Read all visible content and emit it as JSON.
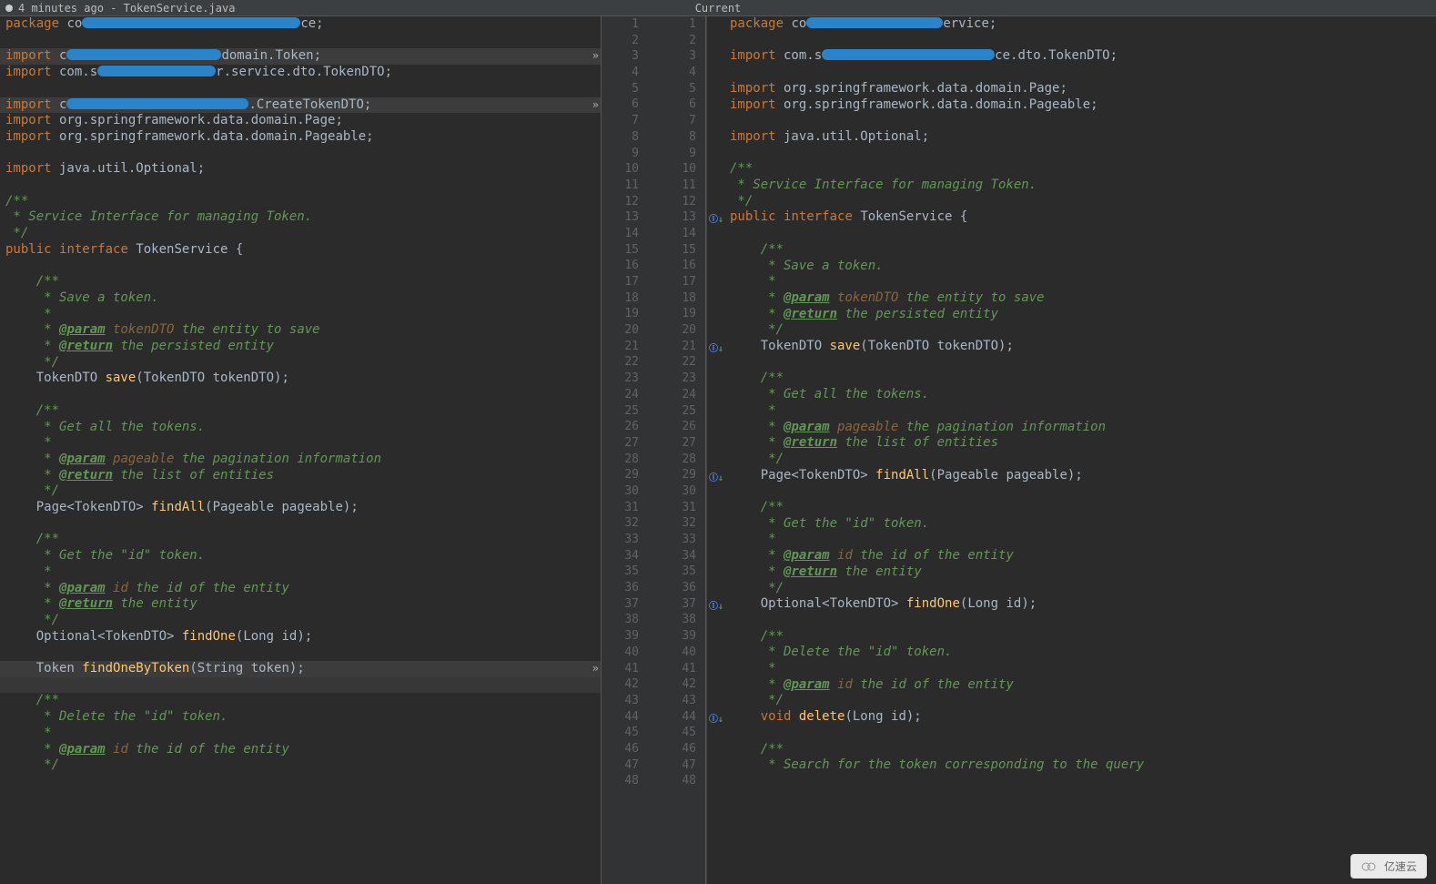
{
  "header": {
    "timestamp": "4 minutes ago",
    "filename": "TokenService.java",
    "center_label": "Current"
  },
  "left": {
    "lines": [
      {
        "n": 1,
        "t": "pkg",
        "raw": "package co[R:240]ce;"
      },
      {
        "n": 2,
        "t": "blank"
      },
      {
        "n": 3,
        "t": "imp",
        "raw": "import c[R:170]domain.Token;",
        "hl": true,
        "chev": true
      },
      {
        "n": 4,
        "t": "imp",
        "raw": "import com.s[R:130]r.service.dto.TokenDTO;"
      },
      {
        "n": 5,
        "t": "blank"
      },
      {
        "n": 6,
        "t": "imp",
        "raw": "import c[R:200].CreateTokenDTO;",
        "hl": true,
        "chev": true
      },
      {
        "n": 7,
        "t": "imp",
        "raw": "import org.springframework.data.domain.Page;"
      },
      {
        "n": 8,
        "t": "imp",
        "raw": "import org.springframework.data.domain.Pageable;"
      },
      {
        "n": 9,
        "t": "blank"
      },
      {
        "n": 10,
        "t": "imp",
        "raw": "import java.util.Optional;"
      },
      {
        "n": 11,
        "t": "blank"
      },
      {
        "n": 12,
        "t": "doc",
        "raw": "/**"
      },
      {
        "n": 13,
        "t": "doc",
        "raw": " * Service Interface for managing Token."
      },
      {
        "n": 14,
        "t": "doc",
        "raw": " */"
      },
      {
        "n": 15,
        "t": "iface",
        "raw": "public interface TokenService {"
      },
      {
        "n": 16,
        "t": "blank"
      },
      {
        "n": 17,
        "t": "doc",
        "raw": "    /**"
      },
      {
        "n": 18,
        "t": "doc",
        "raw": "     * Save a token."
      },
      {
        "n": 19,
        "t": "doc",
        "raw": "     *"
      },
      {
        "n": 20,
        "t": "docp",
        "param": "tokenDTO",
        "rest": "the entity to save"
      },
      {
        "n": 21,
        "t": "docr",
        "rest": "the persisted entity"
      },
      {
        "n": 22,
        "t": "doc",
        "raw": "     */"
      },
      {
        "n": 23,
        "t": "sig",
        "raw": "    TokenDTO save(TokenDTO tokenDTO);",
        "fn": "save"
      },
      {
        "n": 24,
        "t": "blank"
      },
      {
        "n": 25,
        "t": "doc",
        "raw": "    /**"
      },
      {
        "n": 26,
        "t": "doc",
        "raw": "     * Get all the tokens."
      },
      {
        "n": 27,
        "t": "doc",
        "raw": "     *"
      },
      {
        "n": 28,
        "t": "docp",
        "param": "pageable",
        "rest": "the pagination information"
      },
      {
        "n": 29,
        "t": "docr",
        "rest": "the list of entities"
      },
      {
        "n": 30,
        "t": "doc",
        "raw": "     */"
      },
      {
        "n": 31,
        "t": "sig",
        "raw": "    Page<TokenDTO> findAll(Pageable pageable);",
        "fn": "findAll"
      },
      {
        "n": 32,
        "t": "blank"
      },
      {
        "n": 33,
        "t": "doc",
        "raw": "    /**"
      },
      {
        "n": 34,
        "t": "doc",
        "raw": "     * Get the \"id\" token."
      },
      {
        "n": 35,
        "t": "doc",
        "raw": "     *"
      },
      {
        "n": 36,
        "t": "docp",
        "param": "id",
        "rest": "the id of the entity"
      },
      {
        "n": 37,
        "t": "docr",
        "rest": "the entity"
      },
      {
        "n": 38,
        "t": "doc",
        "raw": "     */"
      },
      {
        "n": 39,
        "t": "sig",
        "raw": "    Optional<TokenDTO> findOne(Long id);",
        "fn": "findOne"
      },
      {
        "n": 40,
        "t": "blank"
      },
      {
        "n": 41,
        "t": "sig",
        "raw": "    Token findOneByToken(String token);",
        "fn": "findOneByToken",
        "hl": true,
        "chev": true
      },
      {
        "n": 42,
        "t": "blank",
        "hl": true,
        "hl2": true
      },
      {
        "n": 43,
        "t": "doc",
        "raw": "    /**"
      },
      {
        "n": 44,
        "t": "doc",
        "raw": "     * Delete the \"id\" token."
      },
      {
        "n": 45,
        "t": "doc",
        "raw": "     *"
      },
      {
        "n": 46,
        "t": "docp",
        "param": "id",
        "rest": "the id of the entity"
      },
      {
        "n": 47,
        "t": "doc",
        "raw": "     */"
      }
    ]
  },
  "right": {
    "lines": [
      {
        "n": 1,
        "t": "pkg",
        "raw": "package co[R:150]ervice;"
      },
      {
        "n": 2,
        "t": "blank"
      },
      {
        "n": 3,
        "t": "imp",
        "raw": "import com.s[R:190]ce.dto.TokenDTO;"
      },
      {
        "n": 4,
        "t": "blank"
      },
      {
        "n": 5,
        "t": "imp",
        "raw": "import org.springframework.data.domain.Page;"
      },
      {
        "n": 6,
        "t": "imp",
        "raw": "import org.springframework.data.domain.Pageable;"
      },
      {
        "n": 7,
        "t": "blank"
      },
      {
        "n": 8,
        "t": "imp",
        "raw": "import java.util.Optional;"
      },
      {
        "n": 9,
        "t": "blank"
      },
      {
        "n": 10,
        "t": "doc",
        "raw": "/**"
      },
      {
        "n": 11,
        "t": "doc",
        "raw": " * Service Interface for managing Token."
      },
      {
        "n": 12,
        "t": "doc",
        "raw": " */"
      },
      {
        "n": 13,
        "t": "iface",
        "raw": "public interface TokenService {",
        "mark": "impl"
      },
      {
        "n": 14,
        "t": "blank"
      },
      {
        "n": 15,
        "t": "doc",
        "raw": "    /**"
      },
      {
        "n": 16,
        "t": "doc",
        "raw": "     * Save a token."
      },
      {
        "n": 17,
        "t": "doc",
        "raw": "     *"
      },
      {
        "n": 18,
        "t": "docp",
        "param": "tokenDTO",
        "rest": "the entity to save"
      },
      {
        "n": 19,
        "t": "docr",
        "rest": "the persisted entity"
      },
      {
        "n": 20,
        "t": "doc",
        "raw": "     */"
      },
      {
        "n": 21,
        "t": "sig",
        "raw": "    TokenDTO save(TokenDTO tokenDTO);",
        "fn": "save",
        "mark": "impl"
      },
      {
        "n": 22,
        "t": "blank"
      },
      {
        "n": 23,
        "t": "doc",
        "raw": "    /**"
      },
      {
        "n": 24,
        "t": "doc",
        "raw": "     * Get all the tokens."
      },
      {
        "n": 25,
        "t": "doc",
        "raw": "     *"
      },
      {
        "n": 26,
        "t": "docp",
        "param": "pageable",
        "rest": "the pagination information"
      },
      {
        "n": 27,
        "t": "docr",
        "rest": "the list of entities"
      },
      {
        "n": 28,
        "t": "doc",
        "raw": "     */"
      },
      {
        "n": 29,
        "t": "sig",
        "raw": "    Page<TokenDTO> findAll(Pageable pageable);",
        "fn": "findAll",
        "mark": "impl"
      },
      {
        "n": 30,
        "t": "blank"
      },
      {
        "n": 31,
        "t": "doc",
        "raw": "    /**"
      },
      {
        "n": 32,
        "t": "doc",
        "raw": "     * Get the \"id\" token."
      },
      {
        "n": 33,
        "t": "doc",
        "raw": "     *"
      },
      {
        "n": 34,
        "t": "docp",
        "param": "id",
        "rest": "the id of the entity"
      },
      {
        "n": 35,
        "t": "docr",
        "rest": "the entity"
      },
      {
        "n": 36,
        "t": "doc",
        "raw": "     */"
      },
      {
        "n": 37,
        "t": "sig",
        "raw": "    Optional<TokenDTO> findOne(Long id);",
        "fn": "findOne",
        "mark": "impl"
      },
      {
        "n": 38,
        "t": "blank"
      },
      {
        "n": 39,
        "t": "doc",
        "raw": "    /**"
      },
      {
        "n": 40,
        "t": "doc",
        "raw": "     * Delete the \"id\" token."
      },
      {
        "n": 41,
        "t": "doc",
        "raw": "     *"
      },
      {
        "n": 42,
        "t": "docp",
        "param": "id",
        "rest": "the id of the entity"
      },
      {
        "n": 43,
        "t": "doc",
        "raw": "     */"
      },
      {
        "n": 44,
        "t": "sig",
        "raw": "    void delete(Long id);",
        "fn": "delete",
        "mark": "impl"
      },
      {
        "n": 45,
        "t": "blank"
      },
      {
        "n": 46,
        "t": "doc",
        "raw": "    /**"
      },
      {
        "n": 47,
        "t": "doc",
        "raw": "     * Search for the token corresponding to the query"
      }
    ]
  },
  "right_gutter_numbers": [
    1,
    2,
    3,
    4,
    5,
    6,
    7,
    8,
    9,
    10,
    11,
    12,
    13,
    14,
    15,
    16,
    17,
    18,
    19,
    20,
    21,
    22,
    23,
    24,
    25,
    26,
    27,
    28,
    29,
    30,
    31,
    32,
    33,
    34,
    35,
    36,
    37,
    38,
    39,
    40,
    41,
    42,
    43,
    44,
    45,
    46,
    47,
    48
  ],
  "left_gutter_numbers": [
    1,
    2,
    3,
    4,
    5,
    6,
    7,
    8,
    9,
    10,
    11,
    12,
    13,
    14,
    15,
    16,
    17,
    18,
    19,
    20,
    21,
    22,
    23,
    24,
    25,
    26,
    27,
    28,
    29,
    30,
    31,
    32,
    33,
    34,
    35,
    36,
    37,
    38,
    39,
    40,
    41,
    42,
    43,
    44,
    45,
    46,
    47,
    48
  ],
  "watermark": "亿速云"
}
